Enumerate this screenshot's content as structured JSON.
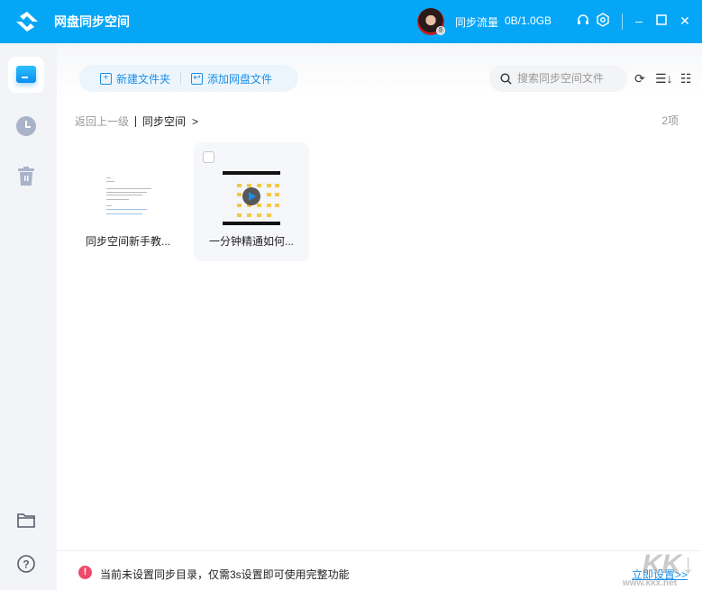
{
  "titlebar": {
    "title": "网盘同步空间",
    "flow_label": "同步流量",
    "flow_value": "0B/1.0GB",
    "avatar_badge": "5"
  },
  "toolbar": {
    "new_folder": "新建文件夹",
    "add_netdisk_file": "添加网盘文件",
    "search_placeholder": "搜索同步空间文件"
  },
  "breadcrumb": {
    "back": "返回上一级",
    "current": "同步空间",
    "arrow": ">"
  },
  "item_count": "2项",
  "files": [
    {
      "name": "同步空间新手教...",
      "type": "document"
    },
    {
      "name": "一分钟精通如何...",
      "type": "video"
    }
  ],
  "footer": {
    "warning": "当前未设置同步目录，仅需3s设置即可使用完整功能",
    "action": "立即设置>>"
  },
  "watermark": {
    "logo": "KK下载",
    "url": "www.kkx.net"
  },
  "colors": {
    "brand": "#06a6f7",
    "accent": "#1a8fe8",
    "warning": "#f04a6a"
  }
}
